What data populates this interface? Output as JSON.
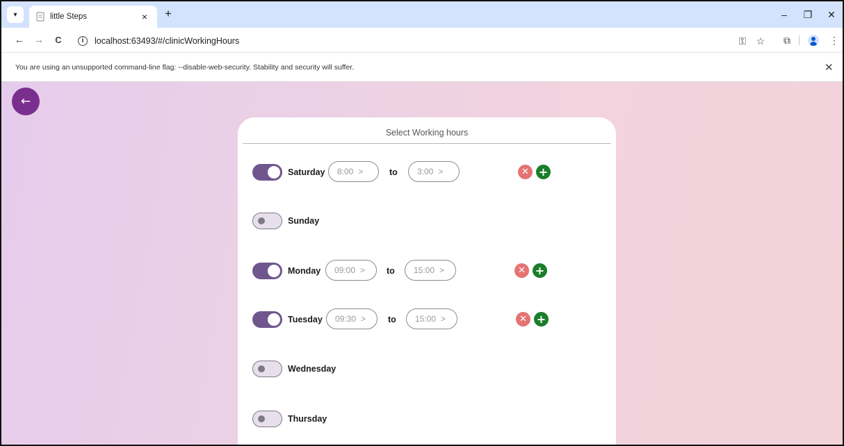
{
  "browser": {
    "tab_title": "little Steps",
    "tab_close_glyph": "×",
    "new_tab_glyph": "+",
    "url": "localhost:63493/#/clinicWorkingHours",
    "minimize_glyph": "–",
    "restore_glyph": "❐",
    "close_glyph": "✕",
    "back_glyph": "←",
    "forward_glyph": "→",
    "reload_glyph": "C",
    "key_glyph": "⚿",
    "star_glyph": "☆",
    "extensions_glyph": "⧉",
    "menu_glyph": "⋮",
    "tab_search_glyph": "▾"
  },
  "infobar": {
    "text": "You are using an unsupported command-line flag: --disable-web-security. Stability and security will suffer.",
    "close_glyph": "✕"
  },
  "page": {
    "back_glyph": "←",
    "title": "Select Working hours",
    "to_label": "to",
    "remove_glyph": "✕",
    "add_glyph": "+",
    "chevron": ">",
    "colors": {
      "accent": "#7a2f8e",
      "toggle_on": "#6f578e",
      "remove": "#e57373",
      "add": "#1b7d2b"
    },
    "days": [
      {
        "name": "Saturday",
        "enabled": true,
        "from": "8:00",
        "to": "3:00"
      },
      {
        "name": "Sunday",
        "enabled": false
      },
      {
        "name": "Monday",
        "enabled": true,
        "from": "09:00",
        "to": "15:00"
      },
      {
        "name": "Tuesday",
        "enabled": true,
        "from": "09:30",
        "to": "15:00"
      },
      {
        "name": "Wednesday",
        "enabled": false
      },
      {
        "name": "Thursday",
        "enabled": false
      }
    ]
  }
}
